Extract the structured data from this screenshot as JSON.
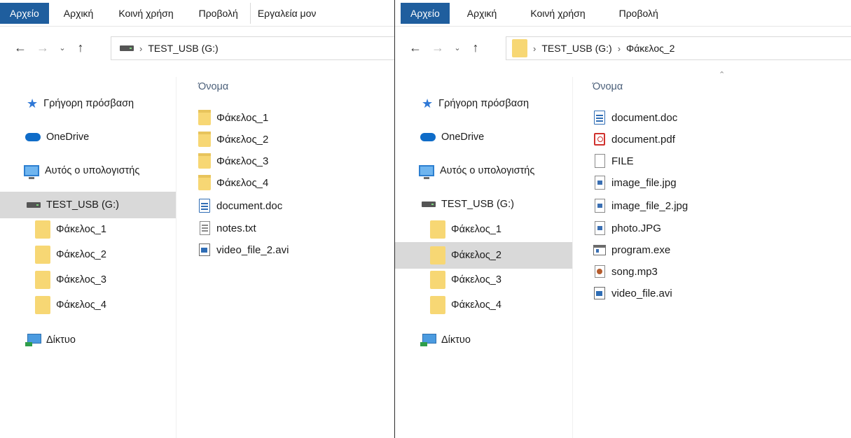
{
  "left_window": {
    "ribbon": {
      "file_tab": "Αρχείο",
      "tabs": [
        "Αρχική",
        "Κοινή χρήση",
        "Προβολή"
      ],
      "extra_tab": "Εργαλεία μον"
    },
    "address": {
      "crumbs": [
        "TEST_USB (G:)"
      ]
    },
    "tree": [
      {
        "label": "Γρήγορη πρόσβαση",
        "icon": "star-icon"
      },
      {
        "label": "OneDrive",
        "icon": "cloud-icon"
      },
      {
        "label": "Αυτός ο υπολογιστής",
        "icon": "pc-icon"
      },
      {
        "label": "TEST_USB (G:)",
        "icon": "drive-icon",
        "selected": true
      },
      {
        "label": "Φάκελος_1",
        "icon": "folder-icon"
      },
      {
        "label": "Φάκελος_2",
        "icon": "folder-icon"
      },
      {
        "label": "Φάκελος_3",
        "icon": "folder-icon"
      },
      {
        "label": "Φάκελος_4",
        "icon": "folder-icon"
      },
      {
        "label": "Δίκτυο",
        "icon": "network-icon"
      }
    ],
    "column_header": "Όνομα",
    "files": [
      {
        "name": "Φάκελος_1",
        "icon": "folder-icon"
      },
      {
        "name": "Φάκελος_2",
        "icon": "folder-icon"
      },
      {
        "name": "Φάκελος_3",
        "icon": "folder-icon"
      },
      {
        "name": "Φάκελος_4",
        "icon": "folder-icon"
      },
      {
        "name": "document.doc",
        "icon": "doc-icon"
      },
      {
        "name": "notes.txt",
        "icon": "txt-icon"
      },
      {
        "name": "video_file_2.avi",
        "icon": "video-icon"
      }
    ]
  },
  "right_window": {
    "ribbon": {
      "file_tab": "Αρχείο",
      "tabs": [
        "Αρχική",
        "Κοινή χρήση",
        "Προβολή"
      ]
    },
    "address": {
      "crumbs": [
        "TEST_USB (G:)",
        "Φάκελος_2"
      ]
    },
    "tree": [
      {
        "label": "Γρήγορη πρόσβαση",
        "icon": "star-icon"
      },
      {
        "label": "OneDrive",
        "icon": "cloud-icon"
      },
      {
        "label": "Αυτός ο υπολογιστής",
        "icon": "pc-icon"
      },
      {
        "label": "TEST_USB (G:)",
        "icon": "drive-icon"
      },
      {
        "label": "Φάκελος_1",
        "icon": "folder-icon"
      },
      {
        "label": "Φάκελος_2",
        "icon": "folder-icon",
        "selected": true
      },
      {
        "label": "Φάκελος_3",
        "icon": "folder-icon"
      },
      {
        "label": "Φάκελος_4",
        "icon": "folder-icon"
      },
      {
        "label": "Δίκτυο",
        "icon": "network-icon"
      }
    ],
    "column_header": "Όνομα",
    "files": [
      {
        "name": "document.doc",
        "icon": "doc-icon"
      },
      {
        "name": "document.pdf",
        "icon": "pdf-icon"
      },
      {
        "name": "FILE",
        "icon": "blank-file-icon"
      },
      {
        "name": "image_file.jpg",
        "icon": "image-icon"
      },
      {
        "name": "image_file_2.jpg",
        "icon": "image-icon"
      },
      {
        "name": "photo.JPG",
        "icon": "image-icon"
      },
      {
        "name": "program.exe",
        "icon": "exe-icon"
      },
      {
        "name": "song.mp3",
        "icon": "audio-icon"
      },
      {
        "name": "video_file.avi",
        "icon": "video-icon"
      }
    ]
  },
  "colors": {
    "file_tab_bg": "#1f5e9e",
    "selection_bg": "#d9d9d9",
    "header_text": "#4c607a"
  }
}
